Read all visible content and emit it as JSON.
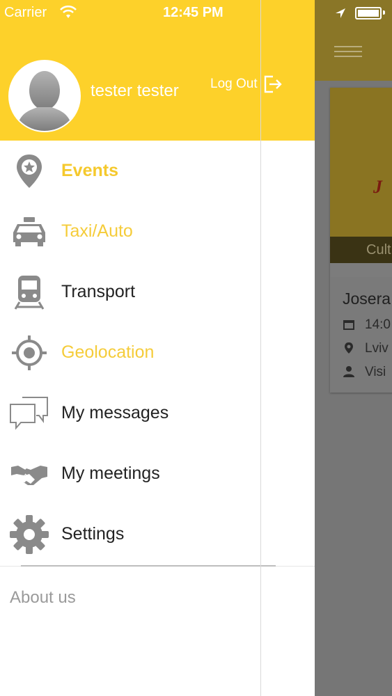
{
  "status_bar": {
    "carrier": "Carrier",
    "time": "12:45 PM"
  },
  "user": {
    "name": "tester tester",
    "logout_label": "Log Out"
  },
  "menu": {
    "items": [
      {
        "label": "Events",
        "icon": "map-pin-star-icon",
        "state": "active"
      },
      {
        "label": "Taxi/Auto",
        "icon": "taxi-icon",
        "state": "highlight"
      },
      {
        "label": "Transport",
        "icon": "train-icon",
        "state": "normal"
      },
      {
        "label": "Geolocation",
        "icon": "crosshair-icon",
        "state": "highlight"
      },
      {
        "label": "My messages",
        "icon": "chat-bubbles-icon",
        "state": "normal"
      },
      {
        "label": "My meetings",
        "icon": "handshake-icon",
        "state": "normal"
      },
      {
        "label": "Settings",
        "icon": "gear-icon",
        "state": "normal"
      }
    ],
    "about_label": "About us"
  },
  "background_card": {
    "tag": "Cult",
    "title": "Josera",
    "date": "14:0",
    "location": "Lviv",
    "visitors": "Visi"
  },
  "colors": {
    "accent": "#fdd12a",
    "active_text": "#f5c92d",
    "text": "#222222",
    "muted": "#9a9a9a"
  }
}
